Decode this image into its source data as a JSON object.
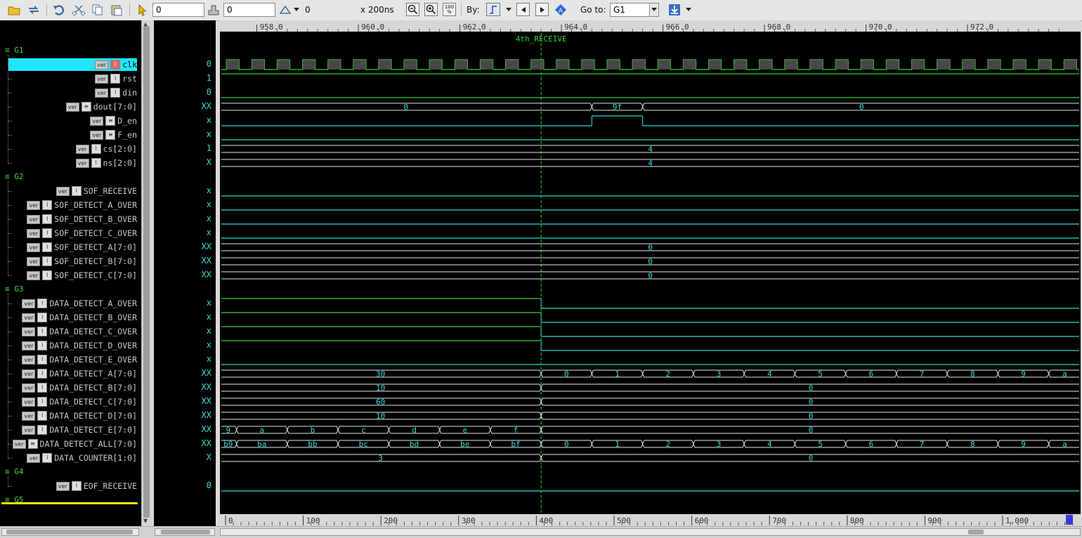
{
  "toolbar": {
    "icons": [
      "folder-open-icon",
      "swap-icon",
      "undo-icon",
      "cut-icon",
      "copy-icon",
      "paste-icon",
      "cursor-icon"
    ],
    "cursor_value": "0",
    "marker_value": "0",
    "delta_label": "0",
    "scale_label": "x 200ns",
    "zoom_100": "100\n%",
    "by_label": "By:",
    "goto_label": "Go to:",
    "goto_value": "G1"
  },
  "colors": {
    "wave_green": "#2fd12f",
    "wave_cyan": "#2fd6d6",
    "value_cyan": "#2fdcdc",
    "group_green": "#41d441",
    "selection": "#1fe5ff",
    "marker": "#e8e8e8"
  },
  "top_ruler": [
    "958.0",
    "960.0",
    "962.0",
    "964.0",
    "966.0",
    "968.0",
    "970.0",
    "972.0"
  ],
  "bottom_ruler": [
    "0",
    "100",
    "200",
    "300",
    "400",
    "500",
    "600",
    "700",
    "800",
    "900",
    "1,000"
  ],
  "marker_label": "4th_RECEIVE",
  "groups": [
    {
      "name": "G1",
      "signals": [
        {
          "name": "clk",
          "icon": "ver",
          "value": "0",
          "selected": true
        },
        {
          "name": "rst",
          "icon": "ver",
          "value": "1"
        },
        {
          "name": "din",
          "icon": "ver",
          "value": "0"
        },
        {
          "name": "dout[7:0]",
          "icon": "ver",
          "value": "XX"
        },
        {
          "name": "D_en",
          "icon": "ver",
          "value": "x"
        },
        {
          "name": "F_en",
          "icon": "ver",
          "value": "x"
        },
        {
          "name": "cs[2:0]",
          "icon": "ver",
          "value": "1"
        },
        {
          "name": "ns[2:0]",
          "icon": "ver",
          "value": "X"
        }
      ]
    },
    {
      "name": "G2",
      "signals": [
        {
          "name": "SOF_RECEIVE",
          "icon": "ver",
          "value": "x"
        },
        {
          "name": "SOF_DETECT_A_OVER",
          "icon": "ver",
          "value": "x"
        },
        {
          "name": "SOF_DETECT_B_OVER",
          "icon": "ver",
          "value": "x"
        },
        {
          "name": "SOF_DETECT_C_OVER",
          "icon": "ver",
          "value": "x"
        },
        {
          "name": "SOF_DETECT_A[7:0]",
          "icon": "ver",
          "value": "XX"
        },
        {
          "name": "SOF_DETECT_B[7:0]",
          "icon": "ver",
          "value": "XX"
        },
        {
          "name": "SOF_DETECT_C[7:0]",
          "icon": "ver",
          "value": "XX"
        }
      ]
    },
    {
      "name": "G3",
      "signals": [
        {
          "name": "DATA_DETECT_A_OVER",
          "icon": "ver",
          "value": "x"
        },
        {
          "name": "DATA_DETECT_B_OVER",
          "icon": "ver",
          "value": "x"
        },
        {
          "name": "DATA_DETECT_C_OVER",
          "icon": "ver",
          "value": "x"
        },
        {
          "name": "DATA_DETECT_D_OVER",
          "icon": "ver",
          "value": "x"
        },
        {
          "name": "DATA_DETECT_E_OVER",
          "icon": "ver",
          "value": "x"
        },
        {
          "name": "DATA_DETECT_A[7:0]",
          "icon": "ver",
          "value": "XX"
        },
        {
          "name": "DATA_DETECT_B[7:0]",
          "icon": "ver",
          "value": "XX"
        },
        {
          "name": "DATA_DETECT_C[7:0]",
          "icon": "ver",
          "value": "XX"
        },
        {
          "name": "DATA_DETECT_D[7:0]",
          "icon": "ver",
          "value": "XX"
        },
        {
          "name": "DATA_DETECT_E[7:0]",
          "icon": "ver",
          "value": "XX"
        },
        {
          "name": "DATA_DETECT_ALL[7:0]",
          "icon": "ver",
          "value": "XX"
        },
        {
          "name": "DATA_COUNTER[1:0]",
          "icon": "ver",
          "value": "X"
        }
      ]
    },
    {
      "name": "G4",
      "signals": [
        {
          "name": "EOF_RECEIVE",
          "icon": "ver",
          "value": "0"
        }
      ]
    },
    {
      "name": "G5",
      "signals": []
    }
  ],
  "waves": {
    "clk_period_ns": 0.5,
    "time_start": 957.3,
    "time_end": 974.2,
    "marker_time": 963.6,
    "rows": {
      "clk": {
        "kind": "clock",
        "color": "green"
      },
      "rst": {
        "kind": "level",
        "segments": [
          {
            "from": 957.3,
            "to": 974.2,
            "level": "high"
          }
        ],
        "color": "green"
      },
      "din": {
        "kind": "level",
        "segments": [
          {
            "from": 957.3,
            "to": 974.2,
            "level": "low"
          }
        ],
        "color": "green"
      },
      "dout[7:0]": {
        "kind": "bus",
        "segments": [
          {
            "from": 957.3,
            "to": 964.6,
            "label": "0"
          },
          {
            "from": 964.6,
            "to": 965.6,
            "label": "9f"
          },
          {
            "from": 965.6,
            "to": 974.2,
            "label": "0"
          }
        ]
      },
      "D_en": {
        "kind": "level",
        "segments": [
          {
            "from": 957.3,
            "to": 964.6,
            "level": "low"
          },
          {
            "from": 964.6,
            "to": 965.6,
            "level": "high"
          },
          {
            "from": 965.6,
            "to": 974.2,
            "level": "low"
          }
        ],
        "color": "cyan"
      },
      "F_en": {
        "kind": "level",
        "segments": [
          {
            "from": 957.3,
            "to": 974.2,
            "level": "low"
          }
        ],
        "color": "cyan"
      },
      "cs[2:0]": {
        "kind": "bus",
        "segments": [
          {
            "from": 957.3,
            "to": 974.2,
            "label": "4"
          }
        ]
      },
      "ns[2:0]": {
        "kind": "bus",
        "segments": [
          {
            "from": 957.3,
            "to": 974.2,
            "label": "4"
          }
        ]
      },
      "SOF_RECEIVE": {
        "kind": "level",
        "segments": [
          {
            "from": 957.3,
            "to": 974.2,
            "level": "low"
          }
        ],
        "color": "cyan"
      },
      "SOF_DETECT_A_OVER": {
        "kind": "level",
        "segments": [
          {
            "from": 957.3,
            "to": 974.2,
            "level": "low"
          }
        ],
        "color": "cyan"
      },
      "SOF_DETECT_B_OVER": {
        "kind": "level",
        "segments": [
          {
            "from": 957.3,
            "to": 974.2,
            "level": "low"
          }
        ],
        "color": "cyan"
      },
      "SOF_DETECT_C_OVER": {
        "kind": "level",
        "segments": [
          {
            "from": 957.3,
            "to": 974.2,
            "level": "low"
          }
        ],
        "color": "cyan"
      },
      "SOF_DETECT_A[7:0]": {
        "kind": "bus",
        "segments": [
          {
            "from": 957.3,
            "to": 974.2,
            "label": "0"
          }
        ]
      },
      "SOF_DETECT_B[7:0]": {
        "kind": "bus",
        "segments": [
          {
            "from": 957.3,
            "to": 974.2,
            "label": "0"
          }
        ]
      },
      "SOF_DETECT_C[7:0]": {
        "kind": "bus",
        "segments": [
          {
            "from": 957.3,
            "to": 974.2,
            "label": "0"
          }
        ]
      },
      "DATA_DETECT_A_OVER": {
        "kind": "level",
        "segments": [
          {
            "from": 957.3,
            "to": 963.6,
            "level": "high",
            "color": "green"
          },
          {
            "from": 963.6,
            "to": 974.2,
            "level": "low"
          }
        ],
        "color": "cyan"
      },
      "DATA_DETECT_B_OVER": {
        "kind": "level",
        "segments": [
          {
            "from": 957.3,
            "to": 963.6,
            "level": "high",
            "color": "green"
          },
          {
            "from": 963.6,
            "to": 974.2,
            "level": "low"
          }
        ],
        "color": "cyan"
      },
      "DATA_DETECT_C_OVER": {
        "kind": "level",
        "segments": [
          {
            "from": 957.3,
            "to": 963.6,
            "level": "high",
            "color": "green"
          },
          {
            "from": 963.6,
            "to": 974.2,
            "level": "low"
          }
        ],
        "color": "cyan"
      },
      "DATA_DETECT_D_OVER": {
        "kind": "level",
        "segments": [
          {
            "from": 957.3,
            "to": 963.6,
            "level": "high",
            "color": "green"
          },
          {
            "from": 963.6,
            "to": 974.2,
            "level": "low"
          }
        ],
        "color": "cyan"
      },
      "DATA_DETECT_E_OVER": {
        "kind": "level",
        "segments": [
          {
            "from": 957.3,
            "to": 974.2,
            "level": "low"
          }
        ],
        "color": "cyan"
      },
      "DATA_DETECT_A[7:0]": {
        "kind": "bus",
        "segments": [
          {
            "from": 957.3,
            "to": 963.6,
            "label": "30"
          },
          {
            "from": 963.6,
            "to": 964.6,
            "label": "0"
          },
          {
            "from": 964.6,
            "to": 965.6,
            "label": "1"
          },
          {
            "from": 965.6,
            "to": 966.6,
            "label": "2"
          },
          {
            "from": 966.6,
            "to": 967.6,
            "label": "3"
          },
          {
            "from": 967.6,
            "to": 968.6,
            "label": "4"
          },
          {
            "from": 968.6,
            "to": 969.6,
            "label": "5"
          },
          {
            "from": 969.6,
            "to": 970.6,
            "label": "6"
          },
          {
            "from": 970.6,
            "to": 971.6,
            "label": "7"
          },
          {
            "from": 971.6,
            "to": 972.6,
            "label": "8"
          },
          {
            "from": 972.6,
            "to": 973.6,
            "label": "9"
          },
          {
            "from": 973.6,
            "to": 974.2,
            "label": "a"
          }
        ]
      },
      "DATA_DETECT_B[7:0]": {
        "kind": "bus",
        "segments": [
          {
            "from": 957.3,
            "to": 963.6,
            "label": "10"
          },
          {
            "from": 963.6,
            "to": 974.2,
            "label": "0"
          }
        ]
      },
      "DATA_DETECT_C[7:0]": {
        "kind": "bus",
        "segments": [
          {
            "from": 957.3,
            "to": 963.6,
            "label": "60"
          },
          {
            "from": 963.6,
            "to": 974.2,
            "label": "0"
          }
        ]
      },
      "DATA_DETECT_D[7:0]": {
        "kind": "bus",
        "segments": [
          {
            "from": 957.3,
            "to": 963.6,
            "label": "10"
          },
          {
            "from": 963.6,
            "to": 974.2,
            "label": "0"
          }
        ]
      },
      "DATA_DETECT_E[7:0]": {
        "kind": "bus",
        "segments": [
          {
            "from": 957.3,
            "to": 957.6,
            "label": "9"
          },
          {
            "from": 957.6,
            "to": 958.6,
            "label": "a"
          },
          {
            "from": 958.6,
            "to": 959.6,
            "label": "b"
          },
          {
            "from": 959.6,
            "to": 960.6,
            "label": "c"
          },
          {
            "from": 960.6,
            "to": 961.6,
            "label": "d"
          },
          {
            "from": 961.6,
            "to": 962.6,
            "label": "e"
          },
          {
            "from": 962.6,
            "to": 963.6,
            "label": "f"
          },
          {
            "from": 963.6,
            "to": 974.2,
            "label": "0"
          }
        ]
      },
      "DATA_DETECT_ALL[7:0]": {
        "kind": "bus",
        "segments": [
          {
            "from": 957.3,
            "to": 957.6,
            "label": "b9"
          },
          {
            "from": 957.6,
            "to": 958.6,
            "label": "ba"
          },
          {
            "from": 958.6,
            "to": 959.6,
            "label": "bb"
          },
          {
            "from": 959.6,
            "to": 960.6,
            "label": "bc"
          },
          {
            "from": 960.6,
            "to": 961.6,
            "label": "bd"
          },
          {
            "from": 961.6,
            "to": 962.6,
            "label": "be"
          },
          {
            "from": 962.6,
            "to": 963.6,
            "label": "bf"
          },
          {
            "from": 963.6,
            "to": 964.6,
            "label": "0"
          },
          {
            "from": 964.6,
            "to": 965.6,
            "label": "1"
          },
          {
            "from": 965.6,
            "to": 966.6,
            "label": "2"
          },
          {
            "from": 966.6,
            "to": 967.6,
            "label": "3"
          },
          {
            "from": 967.6,
            "to": 968.6,
            "label": "4"
          },
          {
            "from": 968.6,
            "to": 969.6,
            "label": "5"
          },
          {
            "from": 969.6,
            "to": 970.6,
            "label": "6"
          },
          {
            "from": 970.6,
            "to": 971.6,
            "label": "7"
          },
          {
            "from": 971.6,
            "to": 972.6,
            "label": "8"
          },
          {
            "from": 972.6,
            "to": 973.6,
            "label": "9"
          },
          {
            "from": 973.6,
            "to": 974.2,
            "label": "a"
          }
        ]
      },
      "DATA_COUNTER[1:0]": {
        "kind": "bus",
        "segments": [
          {
            "from": 957.3,
            "to": 963.6,
            "label": "3"
          },
          {
            "from": 963.6,
            "to": 974.2,
            "label": "0"
          }
        ]
      },
      "EOF_RECEIVE": {
        "kind": "level",
        "segments": [
          {
            "from": 957.3,
            "to": 974.2,
            "level": "low"
          }
        ],
        "color": "cyan"
      }
    }
  }
}
